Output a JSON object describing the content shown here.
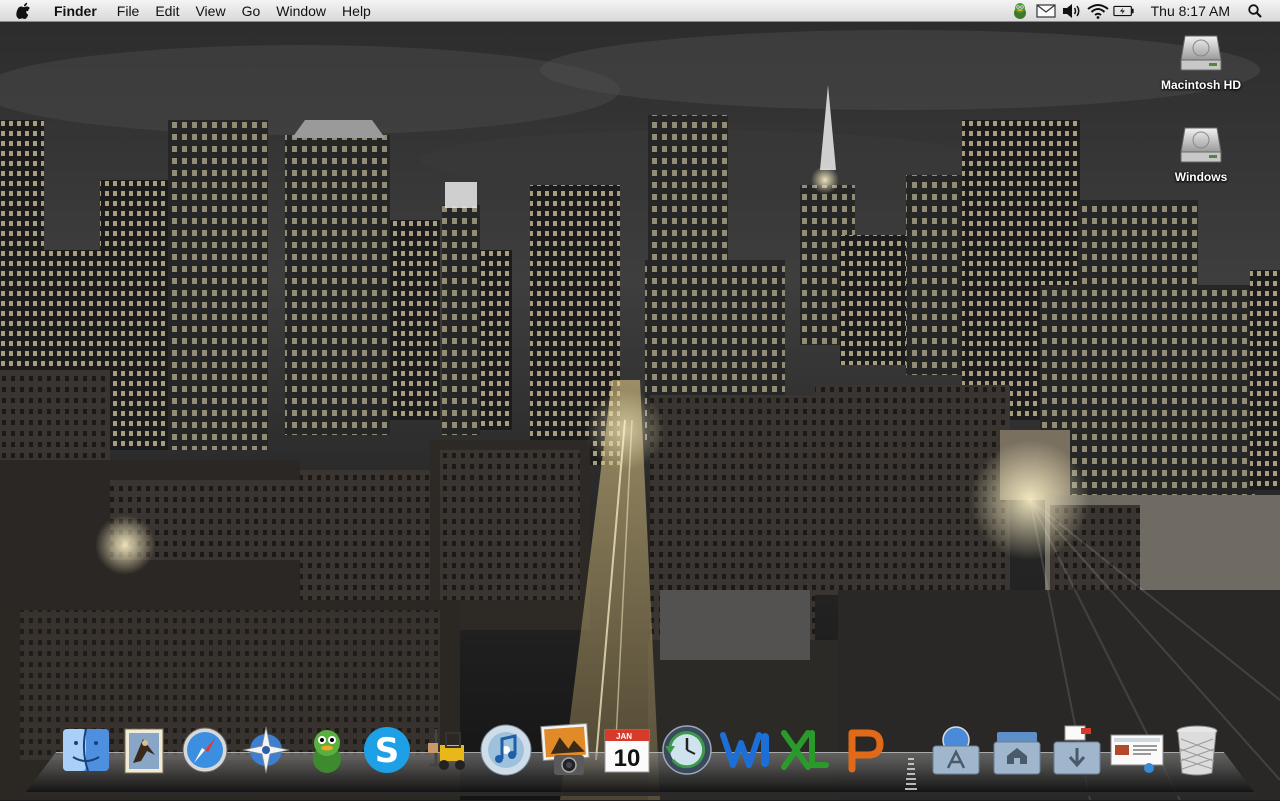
{
  "menubar": {
    "apple_icon": "apple-icon",
    "app_name": "Finder",
    "menus": [
      "File",
      "Edit",
      "View",
      "Go",
      "Window",
      "Help"
    ],
    "status_icons": [
      "adium-icon",
      "mail-icon",
      "volume-icon",
      "wifi-icon",
      "battery-icon"
    ],
    "clock": "Thu 8:17 AM",
    "spotlight_icon": "spotlight-icon"
  },
  "desktop": {
    "icons": [
      {
        "label": "Macintosh HD",
        "icon": "hard-drive-icon"
      },
      {
        "label": "Windows",
        "icon": "hard-drive-icon"
      }
    ]
  },
  "dock": {
    "apps": [
      {
        "icon": "finder-icon"
      },
      {
        "icon": "mail-icon"
      },
      {
        "icon": "safari-icon"
      },
      {
        "icon": "camino-icon"
      },
      {
        "icon": "adium-icon"
      },
      {
        "icon": "skype-icon"
      },
      {
        "icon": "transmit-icon"
      },
      {
        "icon": "itunes-icon"
      },
      {
        "icon": "iphoto-icon"
      },
      {
        "icon": "ical-icon",
        "month": "JAN",
        "day": "10"
      },
      {
        "icon": "time-machine-icon"
      },
      {
        "icon": "word-icon"
      },
      {
        "icon": "excel-icon"
      },
      {
        "icon": "powerpoint-icon"
      }
    ],
    "stacks": [
      {
        "icon": "applications-folder-icon"
      },
      {
        "icon": "home-folder-icon"
      },
      {
        "icon": "downloads-folder-icon"
      },
      {
        "icon": "screenshot-document-icon"
      },
      {
        "icon": "trash-icon"
      }
    ]
  }
}
